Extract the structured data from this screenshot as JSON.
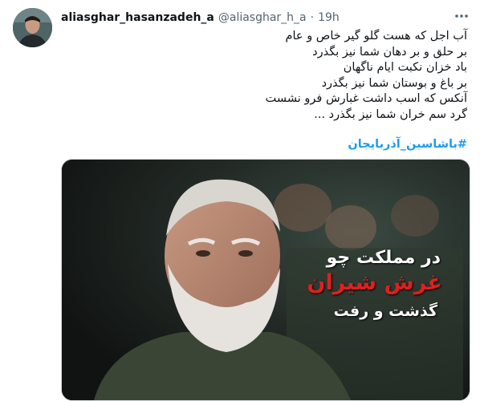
{
  "user": {
    "display_name": "aliasghar_hasanzadeh_a",
    "handle": "@aliasghar_h_a",
    "separator": "·",
    "time": "19h"
  },
  "icons": {
    "more": "more-options-icon"
  },
  "tweet": {
    "lines": [
      "آب اجل که هست گلو گیر خاص و عام",
      "بر حلق و بر دهان شما نیز بگذرد",
      "باد خزان نکبت ایام ناگهان",
      "بر باغ و بوستان شما نیز بگذرد",
      "آنکس که اسب داشت غبارش فرو نشست",
      "گرد سم خران شما نیز بگذرد ..."
    ],
    "hashtag": "#باشاسین_آذربایجان"
  },
  "media": {
    "overlay_line1": "در مملکت چو",
    "overlay_line2": "غرش شیران",
    "overlay_line3": "گذشت و رفت"
  },
  "colors": {
    "link": "#1d9bf0",
    "secondary": "#536471",
    "accent_red": "#e0201f"
  }
}
